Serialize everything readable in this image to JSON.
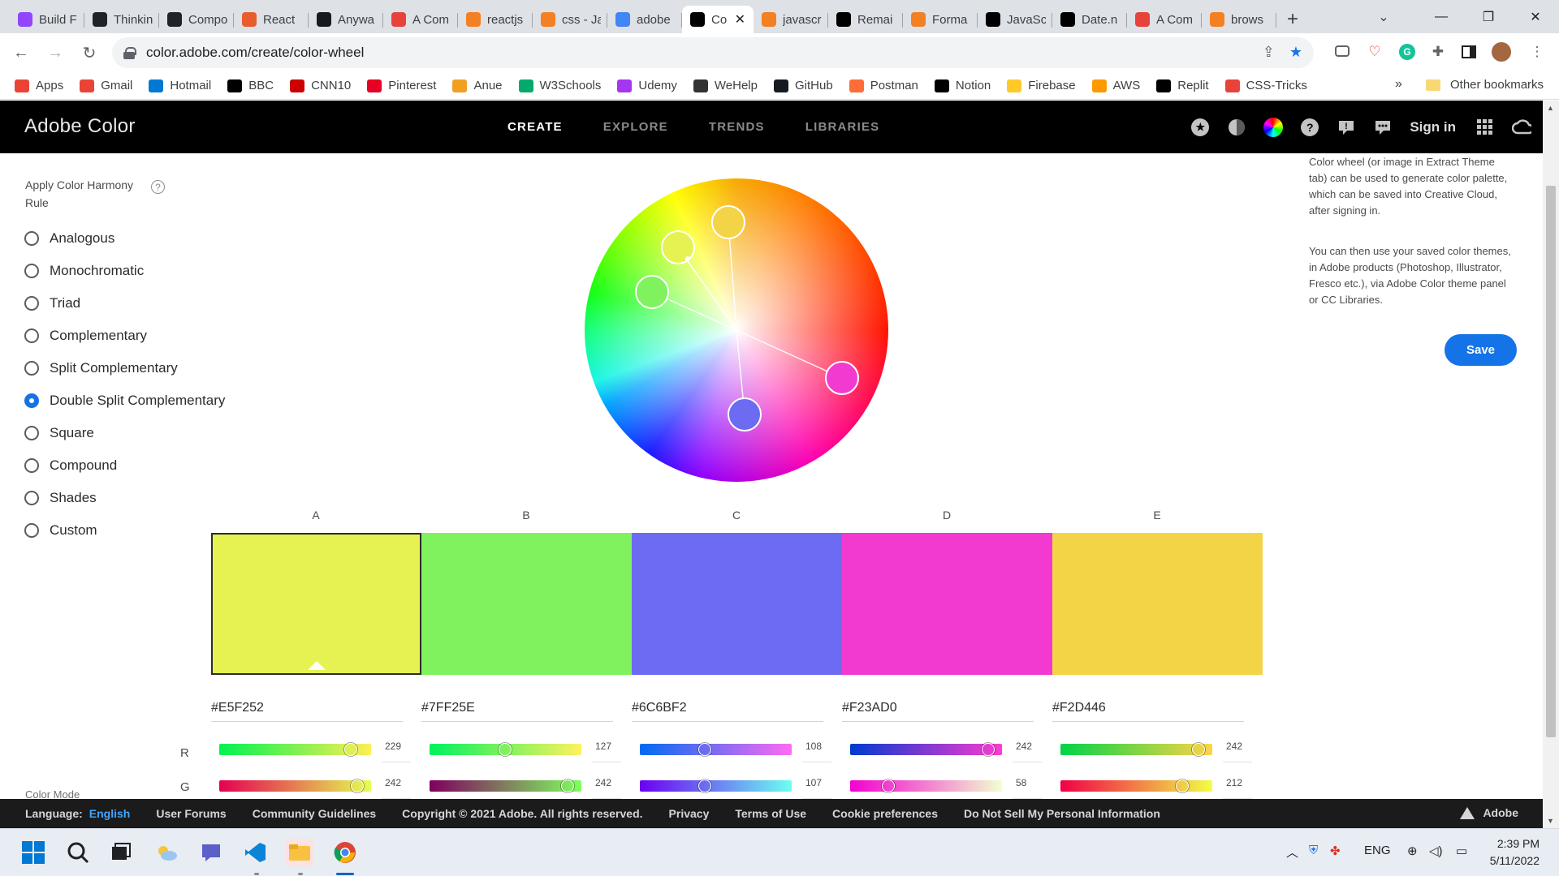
{
  "browser": {
    "tabs": [
      {
        "title": "Build F",
        "icon": "twitch-icon",
        "color": "#9146ff"
      },
      {
        "title": "Thinkin",
        "icon": "react-icon",
        "color": "#20232a"
      },
      {
        "title": "Compo",
        "icon": "react-icon",
        "color": "#20232a"
      },
      {
        "title": "React",
        "icon": "codepen-icon",
        "color": "#e85d2e"
      },
      {
        "title": "Anywa",
        "icon": "github-icon",
        "color": "#161b22"
      },
      {
        "title": "A Com",
        "icon": "asterisk-icon",
        "color": "#e8433b"
      },
      {
        "title": "reactjs",
        "icon": "stackoverflow-icon",
        "color": "#f48024"
      },
      {
        "title": "css - Ja",
        "icon": "stackoverflow-icon",
        "color": "#f48024"
      },
      {
        "title": "adobe",
        "icon": "google-icon",
        "color": "#4285f4"
      },
      {
        "title": "Co",
        "icon": "adobe-color-icon",
        "color": "#000000",
        "active": true
      },
      {
        "title": "javascr",
        "icon": "stackoverflow-icon",
        "color": "#f48024"
      },
      {
        "title": "Remai",
        "icon": "mdn-icon",
        "color": "#000000"
      },
      {
        "title": "Forma",
        "icon": "stackoverflow-icon",
        "color": "#f48024"
      },
      {
        "title": "JavaSc",
        "icon": "javascript-info-icon",
        "color": "#000000"
      },
      {
        "title": "Date.n",
        "icon": "mdn-icon",
        "color": "#000000"
      },
      {
        "title": "A Com",
        "icon": "asterisk-icon",
        "color": "#e8433b"
      },
      {
        "title": "brows",
        "icon": "stackoverflow-icon",
        "color": "#f48024"
      }
    ],
    "new_tab_label": "+",
    "url": "color.adobe.com/create/color-wheel",
    "bookmarks": [
      {
        "label": "Apps",
        "icon": "apps-grid-icon",
        "color": "#ea4335"
      },
      {
        "label": "Gmail",
        "icon": "gmail-icon",
        "color": "#ea4335"
      },
      {
        "label": "Hotmail",
        "icon": "outlook-icon",
        "color": "#0078d4"
      },
      {
        "label": "BBC",
        "icon": "bbc-icon",
        "color": "#000000"
      },
      {
        "label": "CNN10",
        "icon": "cnn-icon",
        "color": "#cc0000"
      },
      {
        "label": "Pinterest",
        "icon": "pinterest-icon",
        "color": "#e60023"
      },
      {
        "label": "Anue",
        "icon": "anue-icon",
        "color": "#f0a020"
      },
      {
        "label": "W3Schools",
        "icon": "w3schools-icon",
        "color": "#04aa6d"
      },
      {
        "label": "Udemy",
        "icon": "udemy-icon",
        "color": "#a435f0"
      },
      {
        "label": "WeHelp",
        "icon": "wehelp-icon",
        "color": "#333333"
      },
      {
        "label": "GitHub",
        "icon": "github-icon",
        "color": "#161b22"
      },
      {
        "label": "Postman",
        "icon": "postman-icon",
        "color": "#ff6c37"
      },
      {
        "label": "Notion",
        "icon": "checkmark-icon",
        "color": "#000000"
      },
      {
        "label": "Firebase",
        "icon": "firebase-icon",
        "color": "#ffca28"
      },
      {
        "label": "AWS",
        "icon": "aws-icon",
        "color": "#ff9900"
      },
      {
        "label": "Replit",
        "icon": "replit-icon",
        "color": "#000000"
      },
      {
        "label": "CSS-Tricks",
        "icon": "asterisk-icon",
        "color": "#e8433b"
      }
    ],
    "bookmarks_more": "»",
    "other_bookmarks": "Other bookmarks"
  },
  "app": {
    "brand": "Adobe Color",
    "nav": [
      {
        "label": "CREATE",
        "active": true
      },
      {
        "label": "EXPLORE",
        "active": false
      },
      {
        "label": "TRENDS",
        "active": false
      },
      {
        "label": "LIBRARIES",
        "active": false
      }
    ],
    "signin": "Sign in"
  },
  "harmony": {
    "title": "Apply Color Harmony Rule",
    "help": "?",
    "rules": [
      {
        "label": "Analogous",
        "selected": false
      },
      {
        "label": "Monochromatic",
        "selected": false
      },
      {
        "label": "Triad",
        "selected": false
      },
      {
        "label": "Complementary",
        "selected": false
      },
      {
        "label": "Split Complementary",
        "selected": false
      },
      {
        "label": "Double Split Complementary",
        "selected": true
      },
      {
        "label": "Square",
        "selected": false
      },
      {
        "label": "Compound",
        "selected": false
      },
      {
        "label": "Shades",
        "selected": false
      },
      {
        "label": "Custom",
        "selected": false
      }
    ],
    "color_mode_label": "Color Mode"
  },
  "swatches": [
    {
      "letter": "A",
      "hex": "#E5F252",
      "color": "#e5f252",
      "selected": true,
      "r": 229,
      "g": 242
    },
    {
      "letter": "B",
      "hex": "#7FF25E",
      "color": "#7ff25e",
      "selected": false,
      "r": 127,
      "g": 242
    },
    {
      "letter": "C",
      "hex": "#6C6BF2",
      "color": "#6c6bf2",
      "selected": false,
      "r": 108,
      "g": 107
    },
    {
      "letter": "D",
      "hex": "#F23AD0",
      "color": "#f23ad0",
      "selected": false,
      "r": 242,
      "g": 58
    },
    {
      "letter": "E",
      "hex": "#F2D446",
      "color": "#f2d446",
      "selected": false,
      "r": 242,
      "g": 212
    }
  ],
  "channels": {
    "r_label": "R",
    "g_label": "G"
  },
  "info": {
    "p1": "Color wheel (or image in Extract Theme tab) can be used to generate color palette, which can be saved into Creative Cloud, after signing in.",
    "p2": "You can then use your saved color themes, in Adobe products (Photoshop, Illustrator, Fresco etc.), via Adobe Color theme panel or CC Libraries.",
    "save": "Save"
  },
  "footer": {
    "language_label": "Language:",
    "language": "English",
    "links": [
      "User Forums",
      "Community Guidelines",
      "Copyright © 2021 Adobe. All rights reserved.",
      "Privacy",
      "Terms of Use",
      "Cookie preferences",
      "Do Not Sell My Personal Information"
    ],
    "brand": "Adobe"
  },
  "taskbar": {
    "lang": "ENG",
    "time": "2:39 PM",
    "date": "5/11/2022"
  }
}
